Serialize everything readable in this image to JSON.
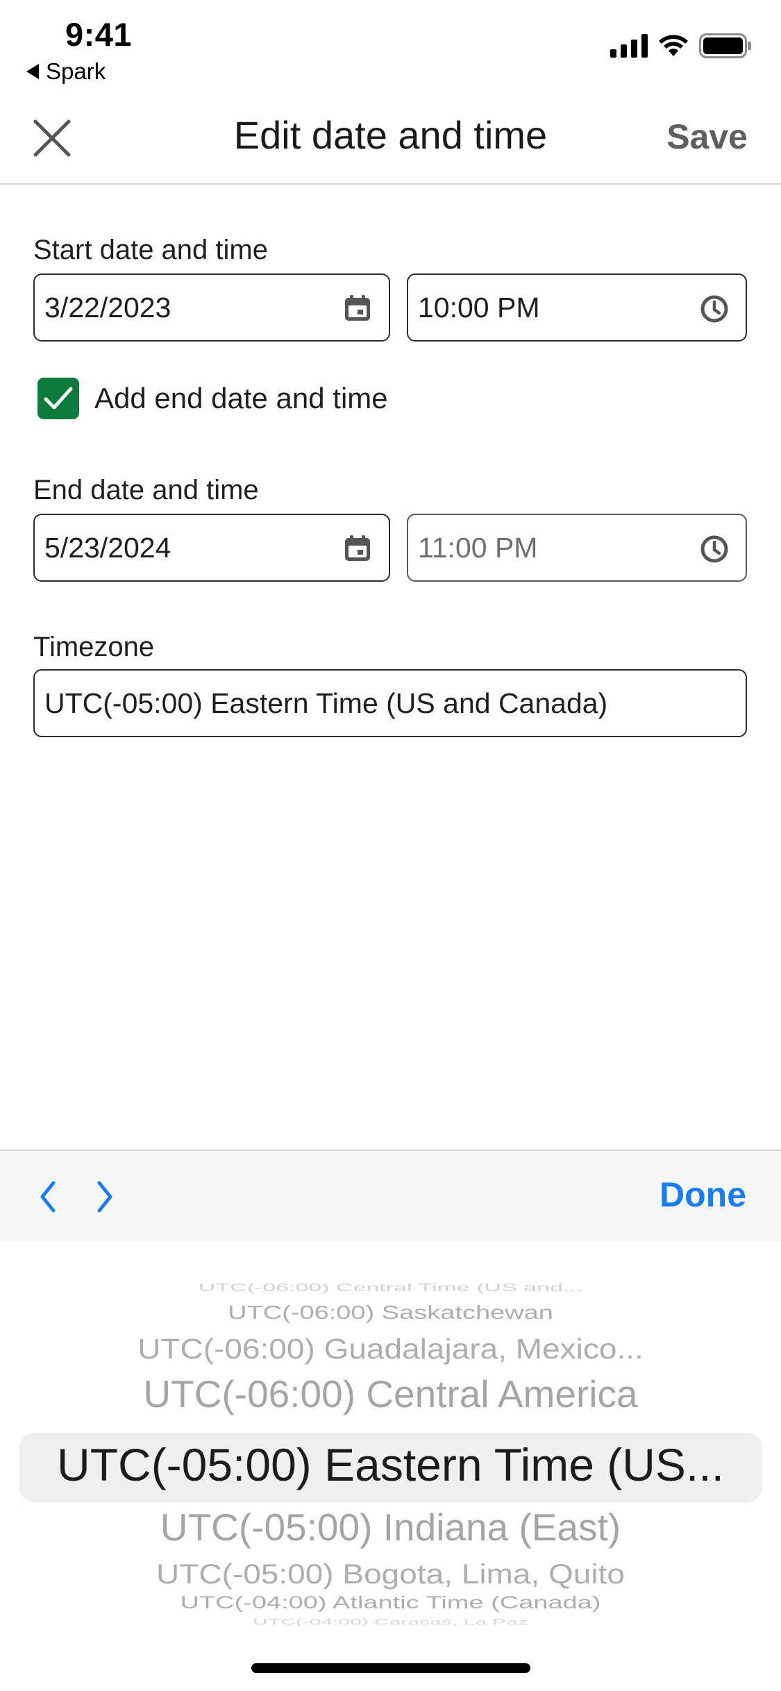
{
  "status_bar": {
    "time": "9:41",
    "back_app": "Spark",
    "icons": [
      "cellular-signal-icon",
      "wifi-icon",
      "battery-icon"
    ]
  },
  "nav": {
    "title": "Edit date and time",
    "save_label": "Save",
    "close_icon": "close-icon"
  },
  "start": {
    "label": "Start date and time",
    "date": "3/22/2023",
    "time": "10:00 PM"
  },
  "end_toggle": {
    "label": "Add end date and time",
    "checked": true
  },
  "end": {
    "label": "End date and time",
    "date": "5/23/2024",
    "time": "11:00 PM"
  },
  "timezone": {
    "label": "Timezone",
    "value": "UTC(-05:00) Eastern Time (US and Canada)"
  },
  "picker_toolbar": {
    "done_label": "Done"
  },
  "picker": {
    "options": [
      "UTC(-06:00) Central Time (US and...",
      "UTC(-06:00) Saskatchewan",
      "UTC(-06:00) Guadalajara, Mexico...",
      "UTC(-06:00) Central America",
      "UTC(-05:00) Eastern Time (US...",
      "UTC(-05:00) Indiana (East)",
      "UTC(-05:00) Bogota, Lima, Quito",
      "UTC(-04:00) Atlantic Time (Canada)",
      "UTC(-04:00) Caracas, La Paz"
    ]
  },
  "colors": {
    "accent": "#1a7cf2",
    "checkbox": "#0b7a3b",
    "text": "#1f1f1f",
    "muted": "#5f5f5f"
  }
}
